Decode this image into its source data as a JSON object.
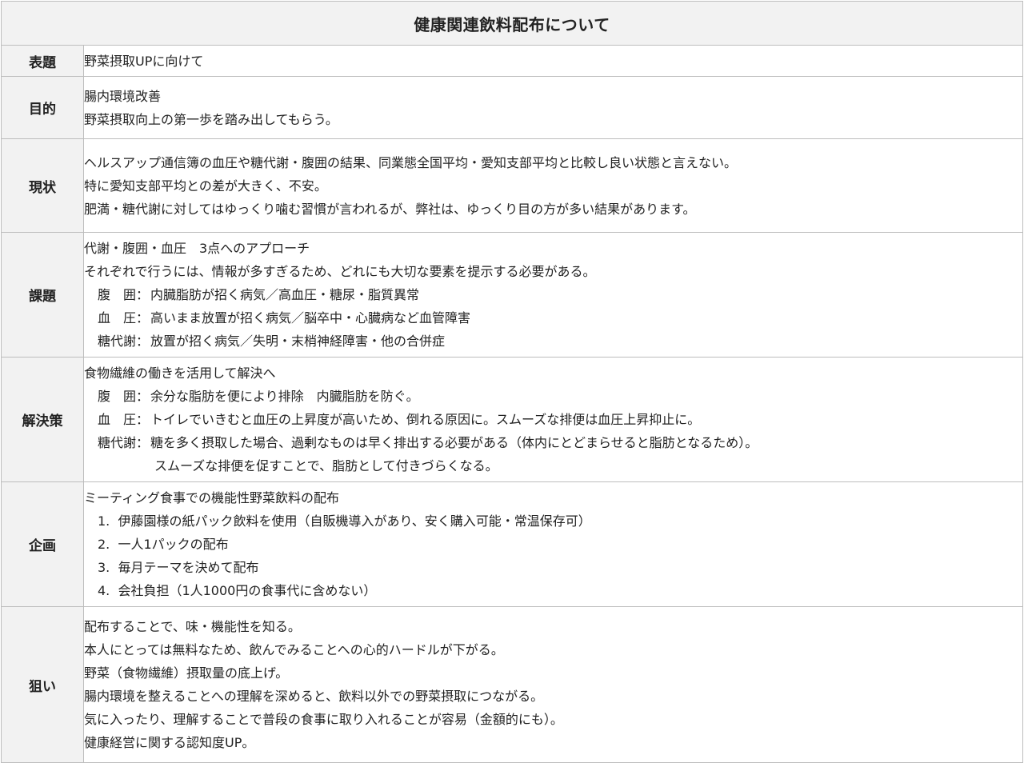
{
  "title": "健康関連飲料配布について",
  "rows": [
    {
      "label": "表題",
      "lines": [
        "野菜摂取UPに向けて"
      ]
    },
    {
      "label": "目的",
      "lines": [
        "腸内環境改善",
        "野菜摂取向上の第一歩を踏み出してもらう。"
      ]
    },
    {
      "label": "現状",
      "lines": [
        "ヘルスアップ通信簿の血圧や糖代謝・腹囲の結果、同業態全国平均・愛知支部平均と比較し良い状態と言えない。",
        "特に愛知支部平均との差が大きく、不安。",
        "肥満・糖代謝に対してはゆっくり噛む習慣が言われるが、弊社は、ゆっくり目の方が多い結果があります。"
      ]
    },
    {
      "label": "課題",
      "lines": [
        "代謝・腹囲・血圧　3点へのアプローチ",
        "それぞれで行うには、情報が多すぎるため、どれにも大切な要素を提示する必要がある。"
      ],
      "items": [
        {
          "tag": "腹　囲：",
          "text": "内臓脂肪が招く病気／高血圧・糖尿・脂質異常"
        },
        {
          "tag": "血　圧：",
          "text": "高いまま放置が招く病気／脳卒中・心臓病など血管障害"
        },
        {
          "tag": "糖代謝：",
          "text": "放置が招く病気／失明・末梢神経障害・他の合併症"
        }
      ]
    },
    {
      "label": "解決策",
      "lines": [
        "食物繊維の働きを活用して解決へ"
      ],
      "items": [
        {
          "tag": "腹　囲：",
          "text": "余分な脂肪を便により排除　内臓脂肪を防ぐ。"
        },
        {
          "tag": "血　圧：",
          "text": "トイレでいきむと血圧の上昇度が高いため、倒れる原因に。スムーズな排便は血圧上昇抑止に。"
        },
        {
          "tag": "糖代謝：",
          "text": "糖を多く摂取した場合、過剰なものは早く排出する必要がある（体内にとどまらせると脂肪となるため）。"
        }
      ],
      "continuation": "スムーズな排便を促すことで、脂肪として付きづらくなる。"
    },
    {
      "label": "企画",
      "lines": [
        "ミーティング食事での機能性野菜飲料の配布"
      ],
      "numbered": [
        "1.  伊藤園様の紙パック飲料を使用（自販機導入があり、安く購入可能・常温保存可）",
        "2.  一人1パックの配布",
        "3.  毎月テーマを決めて配布",
        "4.  会社負担（1人1000円の食事代に含めない）"
      ]
    },
    {
      "label": "狙い",
      "lines": [
        "配布することで、味・機能性を知る。",
        "本人にとっては無料なため、飲んでみることへの心的ハードルが下がる。",
        "野菜（食物繊維）摂取量の底上げ。",
        "腸内環境を整えることへの理解を深めると、飲料以外での野菜摂取につながる。",
        "気に入ったり、理解することで普段の食事に取り入れることが容易（金額的にも）。",
        "健康経営に関する認知度UP。"
      ]
    }
  ]
}
